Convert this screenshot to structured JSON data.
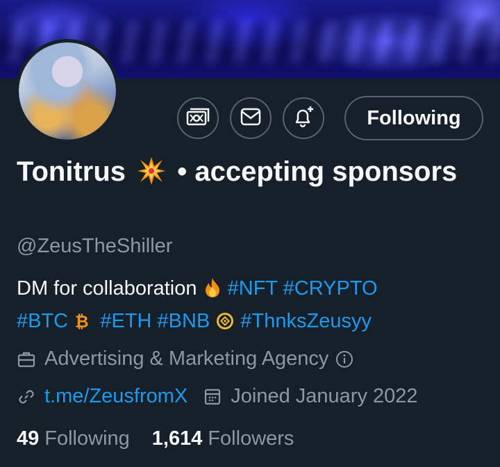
{
  "profile": {
    "name_part1": "Tonitrus",
    "name_part2": "• accepting sponsors",
    "handle": "@ZeusTheShiller",
    "bio": {
      "text": "DM for collaboration",
      "tags_line1": [
        "#NFT",
        "#CRYPTO"
      ],
      "tag_btc": "#BTC",
      "tag_eth": "#ETH",
      "tag_bnb": "#BNB",
      "tag_thanks": "#ThnksZeusyy"
    },
    "category": "Advertising & Marketing Agency",
    "link": "t.me/ZeusfromX",
    "joined": "Joined January 2022",
    "following_count": "49",
    "following_label": "Following",
    "followers_count": "1,614",
    "followers_label": "Followers"
  },
  "actions": {
    "follow_label": "Following"
  },
  "icons": {
    "tip": "money-icon",
    "message": "envelope-icon",
    "notify": "bell-plus-icon",
    "category": "briefcase-icon",
    "info": "info-icon",
    "link": "link-icon",
    "calendar": "calendar-icon"
  },
  "colors": {
    "background": "#15202b",
    "accent": "#1d9bf0",
    "muted": "#8b98a5",
    "border": "#536471"
  }
}
